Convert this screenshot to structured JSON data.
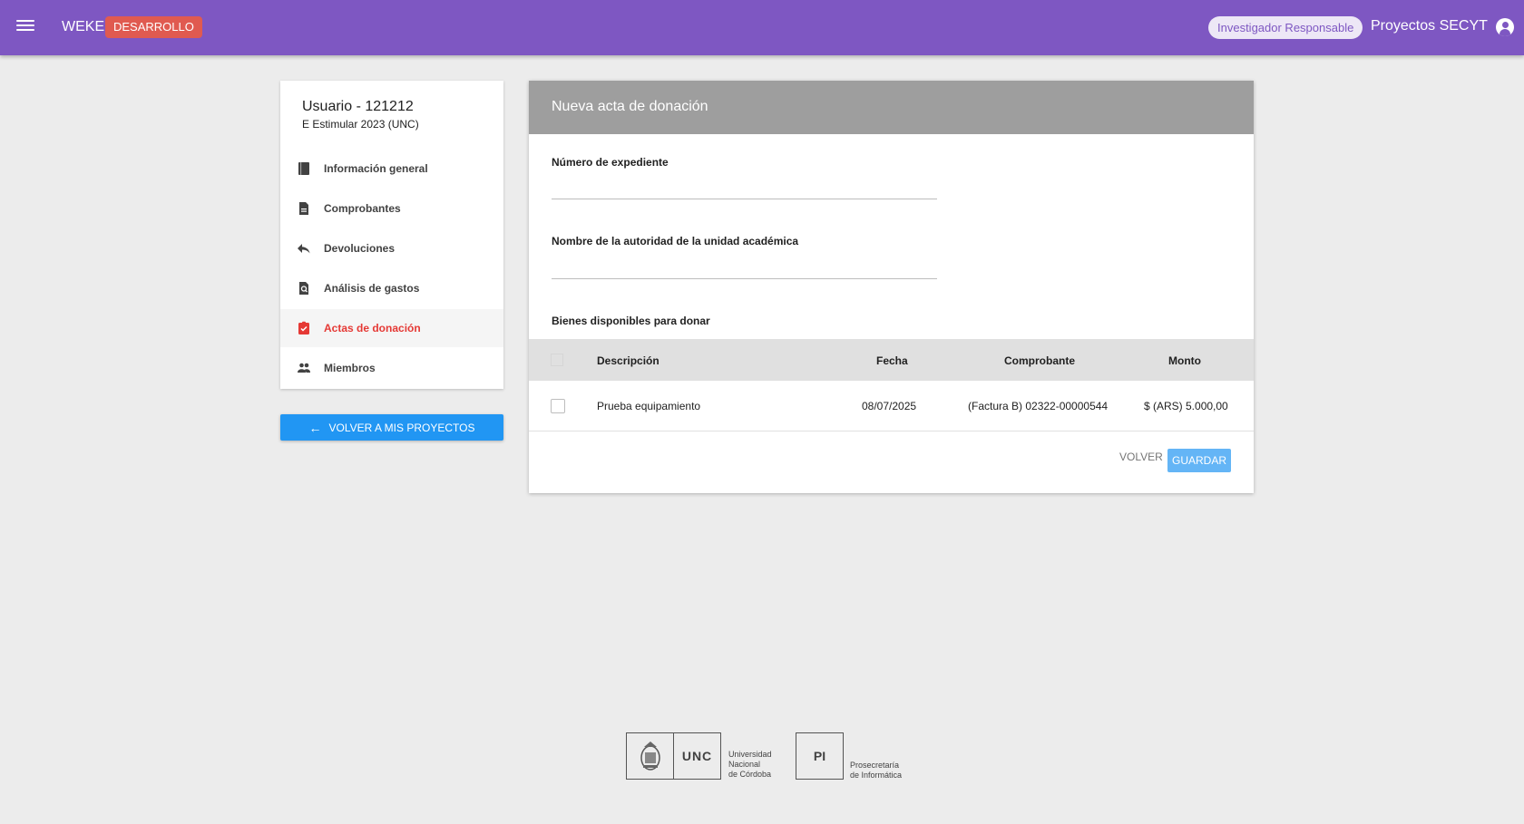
{
  "topbar": {
    "brand": "WEKE",
    "env_badge": "DESARROLLO",
    "role_chip": "Investigador Responsable",
    "app_name": "Proyectos SECYT",
    "color": "#7e57c2"
  },
  "sidebar": {
    "title": "Usuario - 121212",
    "subtitle": "E Estimular 2023 (UNC)",
    "items": [
      {
        "label": "Información general",
        "icon": "book-icon"
      },
      {
        "label": "Comprobantes",
        "icon": "document-icon"
      },
      {
        "label": "Devoluciones",
        "icon": "reply-icon"
      },
      {
        "label": "Análisis de gastos",
        "icon": "find-in-page-icon"
      },
      {
        "label": "Actas de donación",
        "icon": "assignment-check-icon",
        "active": true
      },
      {
        "label": "Miembros",
        "icon": "people-icon"
      }
    ],
    "back_button": "VOLVER A MIS PROYECTOS"
  },
  "form": {
    "header": "Nueva acta de donación",
    "expediente_label": "Número de expediente",
    "expediente_value": "",
    "autoridad_label": "Nombre de la autoridad de la unidad académica",
    "autoridad_value": "",
    "bienes_label": "Bienes disponibles para donar",
    "table": {
      "columns": [
        "Descripción",
        "Fecha",
        "Comprobante",
        "Monto"
      ],
      "rows": [
        {
          "descripcion": "Prueba equipamiento",
          "fecha": "08/07/2025",
          "comprobante": "(Factura B) 02322-00000544",
          "monto": "$ (ARS) 5.000,00",
          "checked": false
        }
      ]
    },
    "volver_label": "VOLVER",
    "guardar_label": "GUARDAR"
  },
  "footer": {
    "unc_abbr": "UNC",
    "unc_line1": "Universidad",
    "unc_line2": "Nacional",
    "unc_line3": "de Córdoba",
    "pi_abbr": "PI",
    "pi_line1": "Prosecretaría",
    "pi_line2": "de Informática"
  }
}
